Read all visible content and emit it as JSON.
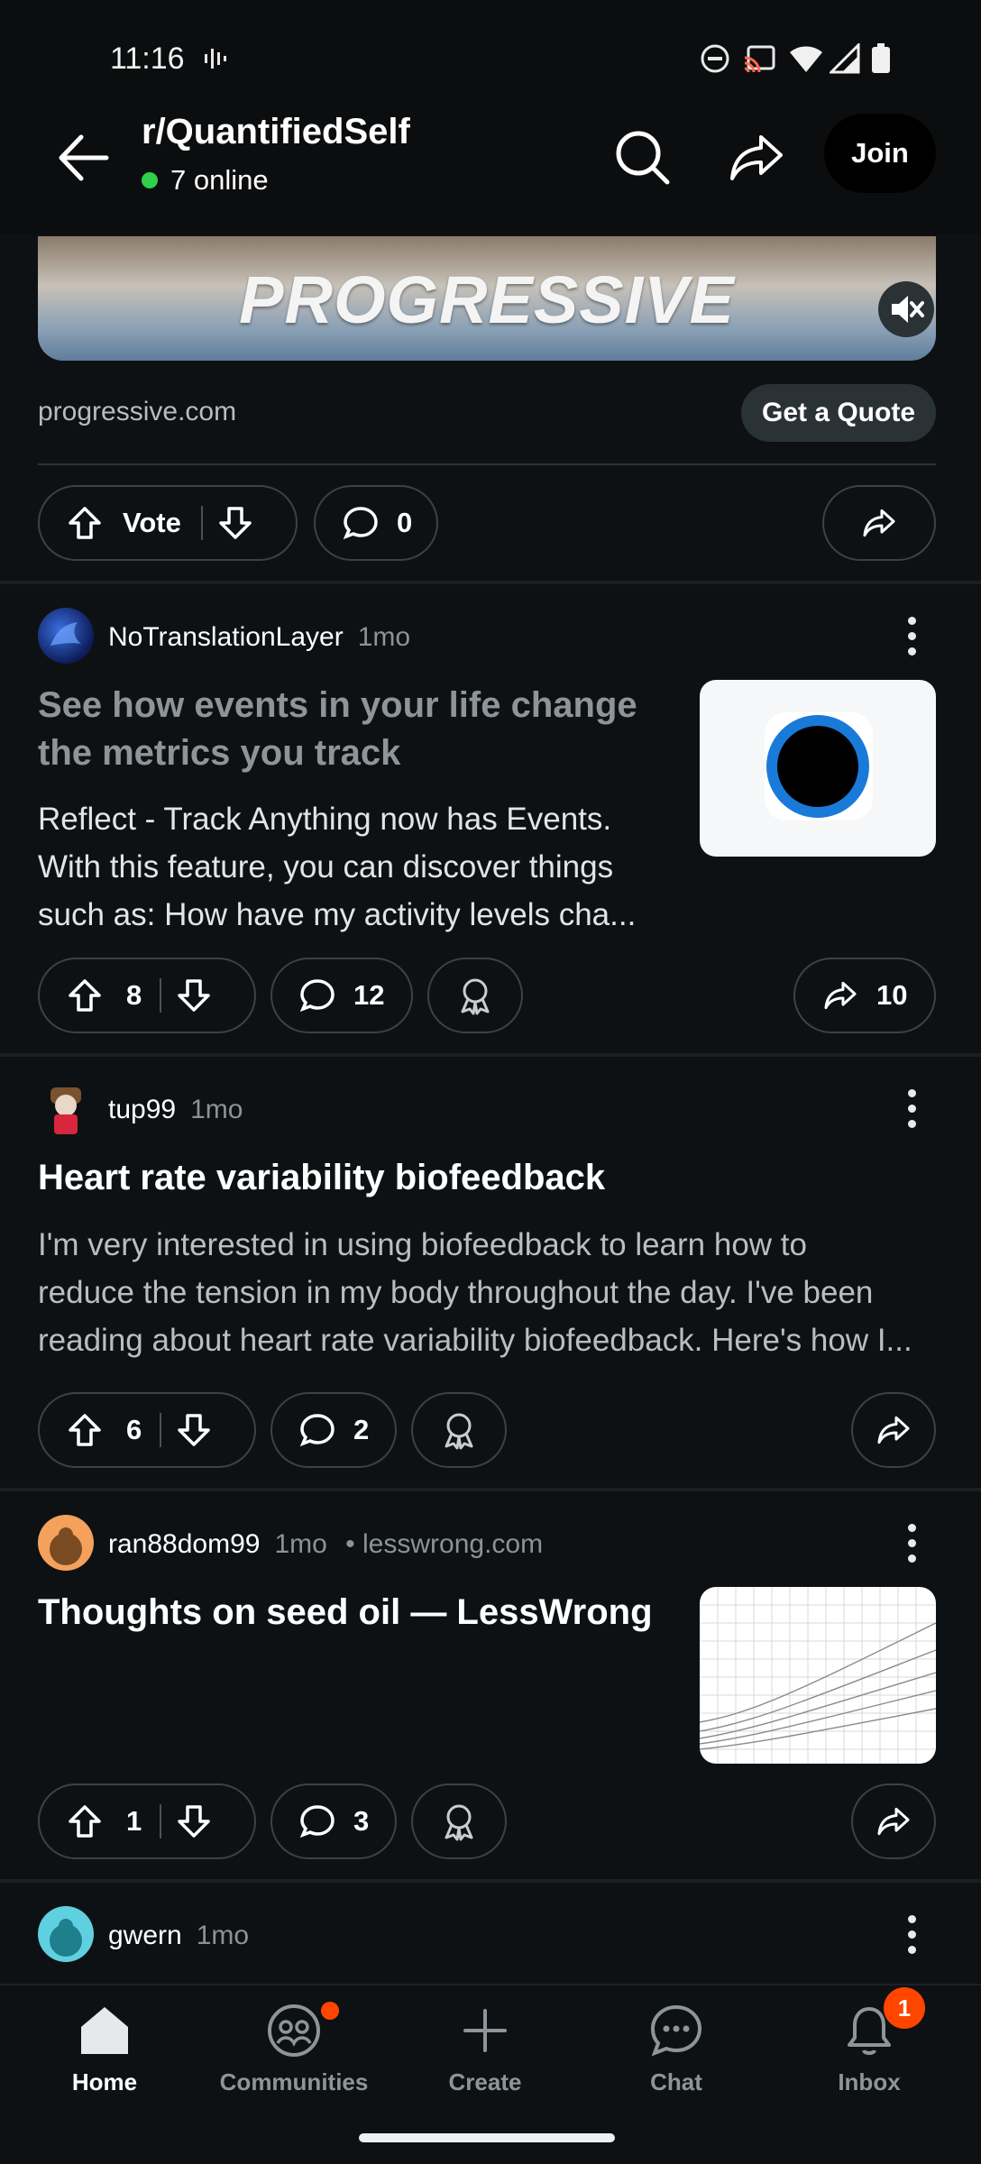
{
  "status_bar": {
    "time": "11:16",
    "icons": [
      "voicemail-icon",
      "do-not-disturb-icon",
      "cast-icon",
      "wifi-icon",
      "signal-icon",
      "battery-icon"
    ]
  },
  "header": {
    "subreddit": "r/QuantifiedSelf",
    "online": "7 online",
    "join_label": "Join"
  },
  "ad": {
    "brand_text": "PROGRESSIVE",
    "domain": "progressive.com",
    "cta": "Get a Quote",
    "vote_label": "Vote",
    "comments": "0"
  },
  "posts": [
    {
      "author": "NoTranslationLayer",
      "age": "1mo",
      "title_lines": [
        "See how events in your life change",
        "the metrics you track"
      ],
      "body_lines": [
        "Reflect - Track Anything now has Events.",
        "With this feature, you can discover things",
        "such as: How have my activity levels cha..."
      ],
      "upvotes": "8",
      "comments": "12",
      "shares": "10"
    },
    {
      "author": "tup99",
      "age": "1mo",
      "title": "Heart rate variability biofeedback",
      "body_lines": [
        "I'm very interested in using biofeedback to learn how to",
        "reduce the tension in my body throughout the day. I've been",
        "reading about heart rate variability biofeedback. Here's how I..."
      ],
      "upvotes": "6",
      "comments": "2"
    },
    {
      "author": "ran88dom99",
      "age": "1mo",
      "domain": "• lesswrong.com",
      "title": "Thoughts on seed oil — LessWrong",
      "upvotes": "1",
      "comments": "3"
    },
    {
      "author": "gwern",
      "age": "1mo"
    }
  ],
  "nav": {
    "items": [
      {
        "label": "Home",
        "icon": "home-icon"
      },
      {
        "label": "Communities",
        "icon": "communities-icon"
      },
      {
        "label": "Create",
        "icon": "plus-icon"
      },
      {
        "label": "Chat",
        "icon": "chat-icon"
      },
      {
        "label": "Inbox",
        "icon": "bell-icon"
      }
    ],
    "inbox_badge": "1"
  },
  "colors": {
    "background": "#0e1113",
    "accent": "#ff4500",
    "online": "#2fd04a",
    "muted_text": "#8c9397"
  }
}
